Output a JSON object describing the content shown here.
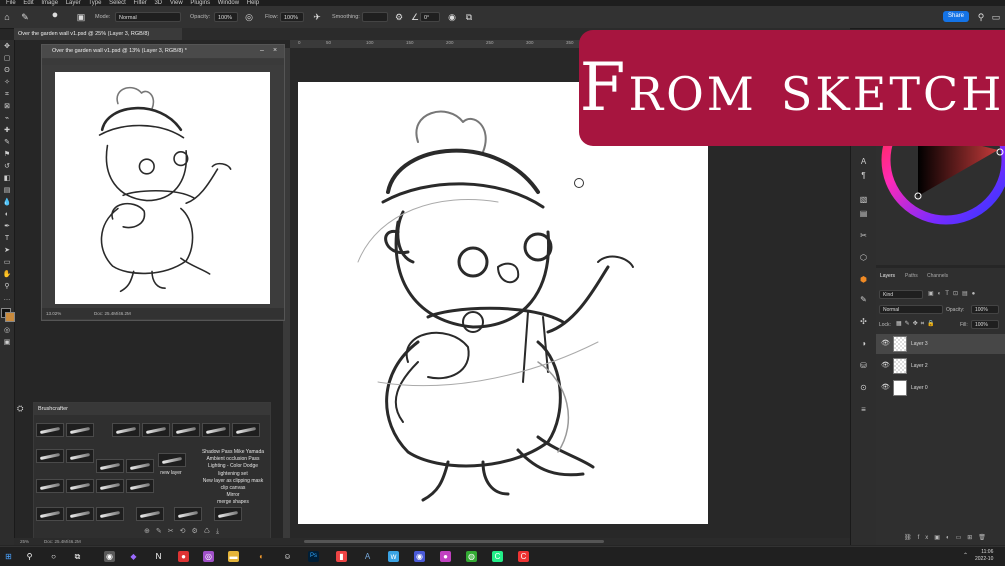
{
  "menu": [
    "File",
    "Edit",
    "Image",
    "Layer",
    "Type",
    "Select",
    "Filter",
    "3D",
    "View",
    "Plugins",
    "Window",
    "Help"
  ],
  "options_bar": {
    "mode_label": "Mode:",
    "mode_value": "Normal",
    "opacity_label": "Opacity:",
    "opacity_value": "100%",
    "flow_label": "Flow:",
    "flow_value": "100%",
    "smoothing_label": "Smoothing:",
    "angle_value": "0°",
    "share_label": "Share"
  },
  "document_tab": "Over the garden wall v1.psd @ 25% (Layer 3, RGB/8)",
  "ruler_ticks": [
    "0",
    "50",
    "100",
    "150",
    "200",
    "250",
    "300",
    "350",
    "400",
    "450",
    "500"
  ],
  "float_window": {
    "title": "Over the garden wall v1.psd @ 13% (Layer 3, RGB/8) *",
    "zoom": "13.02%",
    "doc_info": "Doc: 25.4M/46.2M"
  },
  "brush_panel": {
    "title": "Brushcrafter",
    "notes": [
      "Shadow Pass Mike Yamada",
      "Ambient occlusion Pass",
      "Lighting - Color Dodge",
      "lightening set",
      "New layer as clipping mask",
      "clip canvas",
      "Mirror",
      "merge shapes",
      "new layer"
    ]
  },
  "layers_panel": {
    "tabs": [
      "Layers",
      "Paths",
      "Channels"
    ],
    "kind_filter": "Kind",
    "blend_mode": "Normal",
    "opacity_label": "Opacity:",
    "opacity_value": "100%",
    "lock_label": "Lock:",
    "fill_label": "Fill:",
    "fill_value": "100%",
    "layers": [
      {
        "name": "Layer 3"
      },
      {
        "name": "Layer 2"
      },
      {
        "name": "Layer 0"
      }
    ]
  },
  "status_bar": {
    "zoom": "25%",
    "doc_info": "Doc: 25.4M/46.2M"
  },
  "taskbar": {
    "time": "11:06",
    "date": "2022-10"
  },
  "banner": {
    "text": "From sketch"
  },
  "colors": {
    "banner_bg": "#a7153f",
    "accent": "#1473e6",
    "ps_blue": "#31a8ff"
  }
}
